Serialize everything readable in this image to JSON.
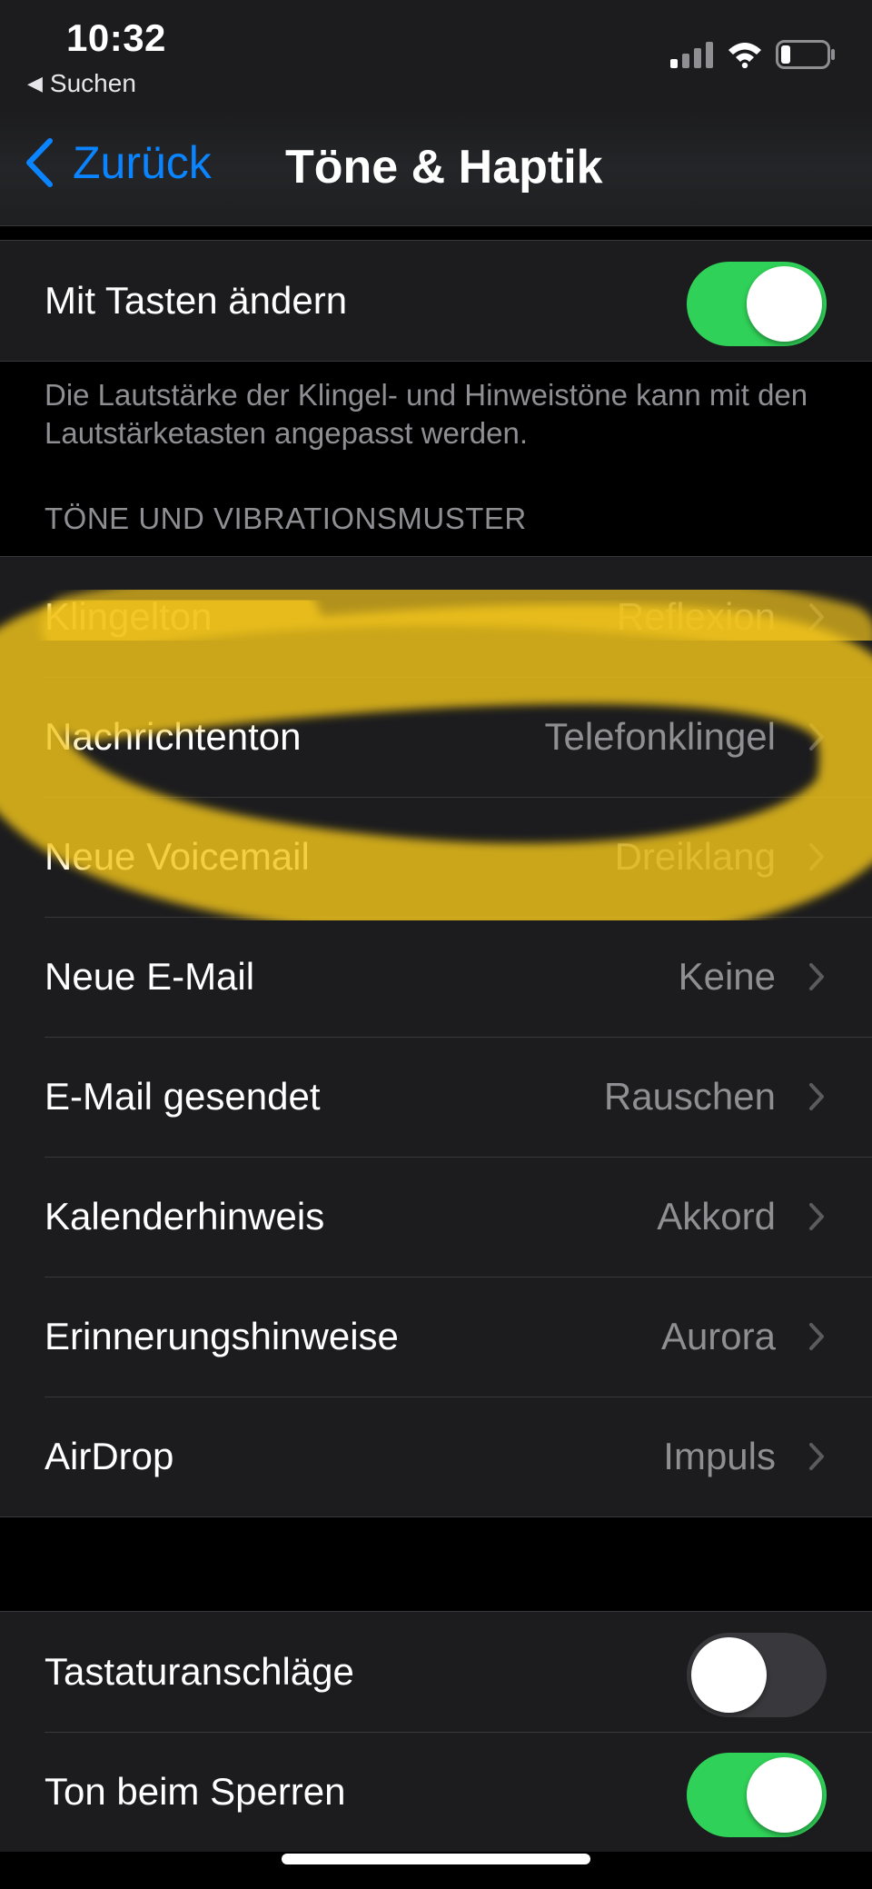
{
  "status_bar": {
    "time": "10:32",
    "back_app": "Suchen"
  },
  "nav": {
    "back_label": "Zurück",
    "title": "Töne & Haptik"
  },
  "volume_group": {
    "change_with_buttons_label": "Mit Tasten ändern",
    "change_with_buttons_on": true,
    "footer": "Die Lautstärke der Klingel- und Hinweistöne kann mit den Lautstärketasten angepasst werden."
  },
  "sounds_section": {
    "header": "TÖNE UND VIBRATIONSMUSTER",
    "items": [
      {
        "label": "Klingelton",
        "value": "Reflexion"
      },
      {
        "label": "Nachrichtenton",
        "value": "Telefonklingel"
      },
      {
        "label": "Neue Voicemail",
        "value": "Dreiklang"
      },
      {
        "label": "Neue E-Mail",
        "value": "Keine"
      },
      {
        "label": "E-Mail gesendet",
        "value": "Rauschen"
      },
      {
        "label": "Kalenderhinweis",
        "value": "Akkord"
      },
      {
        "label": "Erinnerungshinweise",
        "value": "Aurora"
      },
      {
        "label": "AirDrop",
        "value": "Impuls"
      }
    ]
  },
  "other_group": {
    "keyboard_clicks_label": "Tastaturanschläge",
    "keyboard_clicks_on": false,
    "lock_sound_label": "Ton beim Sperren",
    "lock_sound_on": true
  },
  "colors": {
    "accent": "#0a84ff",
    "toggle_on": "#30d158",
    "highlight": "#f2c51b"
  }
}
